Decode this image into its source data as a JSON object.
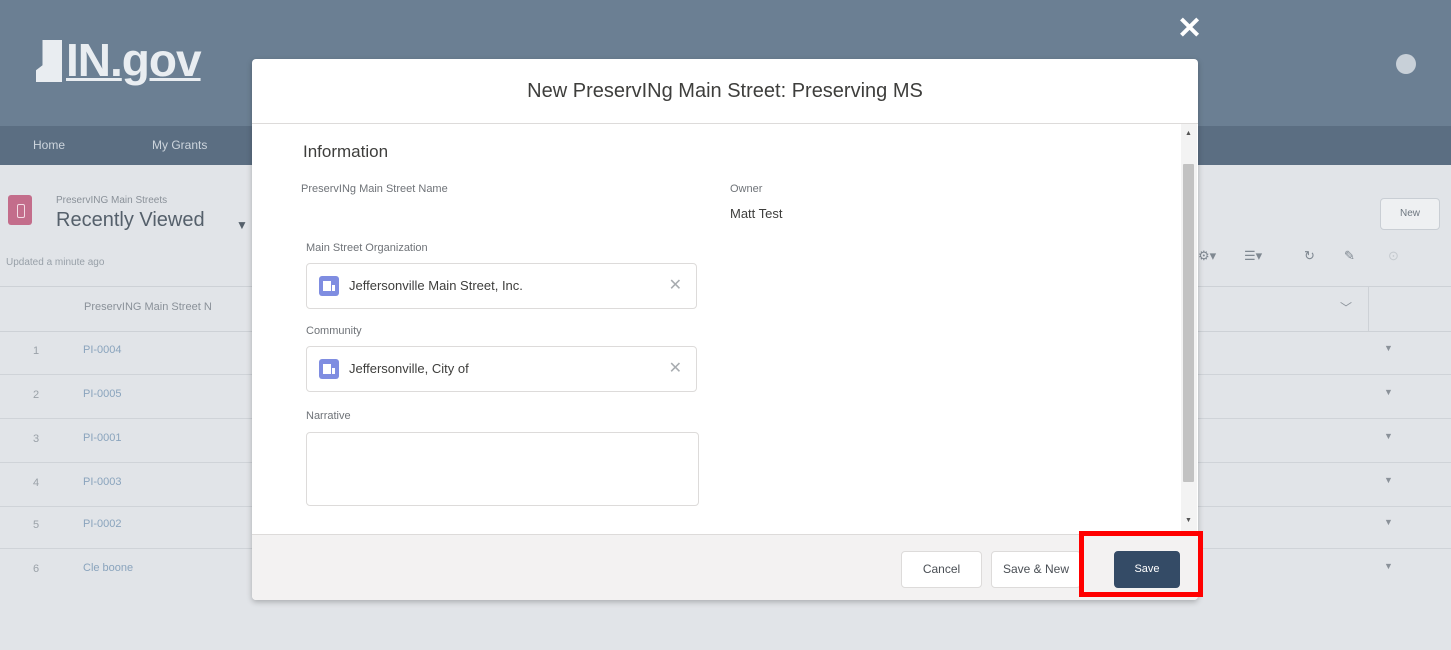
{
  "header": {
    "logo_prefix": "IN.",
    "logo_suffix": "gov"
  },
  "nav": {
    "items": [
      "Home",
      "My Grants"
    ]
  },
  "list_view": {
    "object_label": "PreservING Main Streets",
    "view_name": "Recently Viewed",
    "updated": "Updated a minute ago",
    "new_button": "New",
    "column_header": "PreservING Main Street N",
    "rows": [
      {
        "num": "1",
        "name": "PI-0004"
      },
      {
        "num": "2",
        "name": "PI-0005"
      },
      {
        "num": "3",
        "name": "PI-0001"
      },
      {
        "num": "4",
        "name": "PI-0003"
      },
      {
        "num": "5",
        "name": "PI-0002"
      },
      {
        "num": "6",
        "name": "Cle boone"
      }
    ]
  },
  "modal": {
    "close_icon": "close-icon",
    "title": "New PreservINg Main Street: Preserving MS",
    "section_title": "Information",
    "fields": {
      "name_label": "PreservINg Main Street Name",
      "owner_label": "Owner",
      "owner_value": "Matt Test",
      "organization_label": "Main Street Organization",
      "organization_value": "Jeffersonville Main Street, Inc.",
      "community_label": "Community",
      "community_value": "Jeffersonville, City of",
      "narrative_label": "Narrative",
      "narrative_value": ""
    },
    "buttons": {
      "cancel": "Cancel",
      "save_new": "Save & New",
      "save": "Save"
    }
  },
  "colors": {
    "header_bg": "#6b7f93",
    "primary_button": "#344b66",
    "highlight_box": "#ff0000",
    "lookup_icon": "#7f8de1"
  }
}
